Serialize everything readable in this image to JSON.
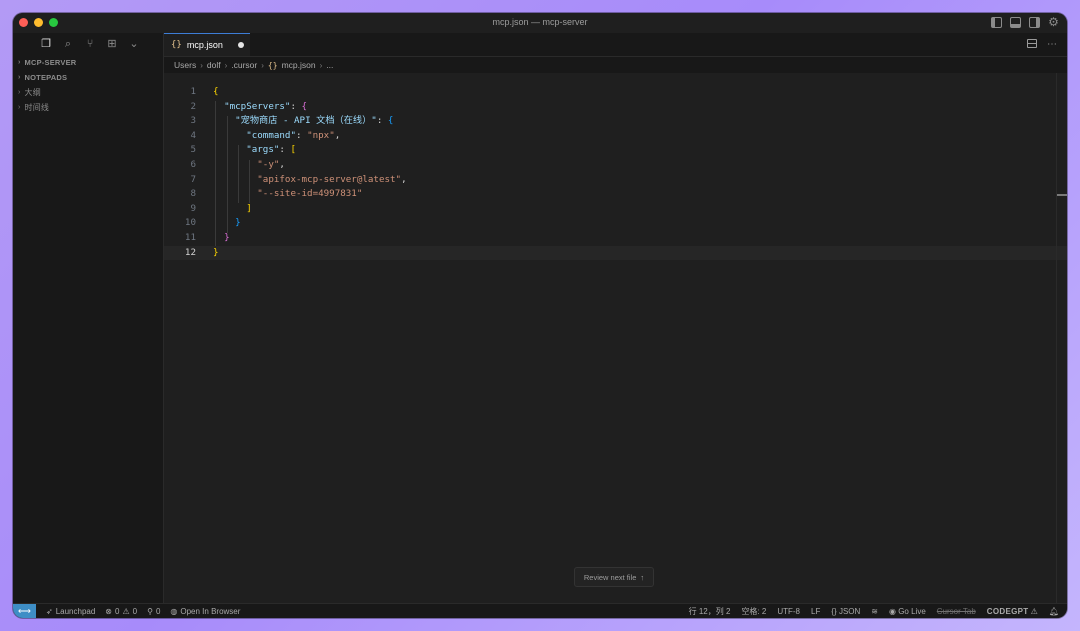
{
  "window": {
    "title": "mcp.json — mcp-server"
  },
  "sidebar": {
    "sections": [
      {
        "label": "MCP-SERVER"
      },
      {
        "label": "NOTEPADS"
      },
      {
        "label": "大纲"
      },
      {
        "label": "时间线"
      }
    ]
  },
  "tab": {
    "icon": "{}",
    "label": "mcp.json"
  },
  "breadcrumb": {
    "items": [
      "Users",
      "dolf",
      ".cursor",
      "mcp.json",
      "..."
    ]
  },
  "editor": {
    "current_line": 12,
    "lines": [
      {
        "n": "1"
      },
      {
        "n": "2",
        "key": "\"mcpServers\""
      },
      {
        "n": "3",
        "key": "\"宠物商店 - API 文档（在线）\""
      },
      {
        "n": "4",
        "key": "\"command\"",
        "value": "\"npx\""
      },
      {
        "n": "5",
        "key": "\"args\""
      },
      {
        "n": "6",
        "value": "\"-y\""
      },
      {
        "n": "7",
        "value": "\"apifox-mcp-server@latest\""
      },
      {
        "n": "8",
        "value": "\"--site-id=4997831\""
      },
      {
        "n": "9"
      },
      {
        "n": "10"
      },
      {
        "n": "11"
      },
      {
        "n": "12"
      }
    ]
  },
  "review_button": {
    "label": "Review next file",
    "shortcut": "↑"
  },
  "statusbar": {
    "launchpad": "Launchpad",
    "errors": "0",
    "warnings": "0",
    "ports": "0",
    "open_in_browser": "Open In Browser",
    "cursor_position": "行 12，列 2",
    "indent": "空格: 2",
    "encoding": "UTF-8",
    "eol": "LF",
    "language": "JSON",
    "go_live": "Go Live",
    "cursor_tab": "Cursor Tab",
    "codegpt": "CODEGPT"
  },
  "colors": {
    "accent": "#3e8ec6",
    "json_key": "#9cdcfe",
    "json_string": "#ce9178",
    "bracket_1": "#ffd700",
    "bracket_2": "#da70d6",
    "bracket_3": "#179fff"
  }
}
